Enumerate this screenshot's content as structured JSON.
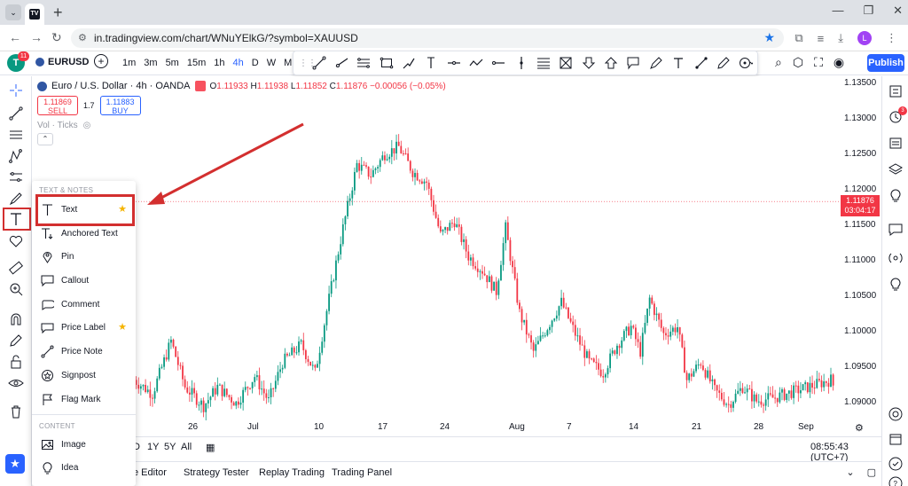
{
  "browser": {
    "url": "in.tradingview.com/chart/WNuYElkG/?symbol=XAUUSD",
    "profile_initial": "L",
    "tab_menu_glyph": "⌄",
    "new_tab_glyph": "+",
    "window_controls": [
      "—",
      "❐",
      "✕"
    ],
    "nav": {
      "back": "←",
      "forward": "→",
      "reload": "↻"
    }
  },
  "topbar": {
    "user_initial": "T",
    "notification_count": "11",
    "symbol": "EURUSD",
    "intervals": [
      "1m",
      "3m",
      "5m",
      "15m",
      "1h",
      "4h",
      "D",
      "W",
      "M"
    ],
    "active_interval": "4h",
    "publish_label": "Publish"
  },
  "chart": {
    "legend_title": "Euro / U.S. Dollar · 4h · OANDA",
    "ohlc": {
      "o_label": "O",
      "o": "1.11933",
      "h_label": "H",
      "h": "1.11938",
      "l_label": "L",
      "l": "1.11852",
      "c_label": "C",
      "c": "1.11876",
      "change": "−0.00056 (−0.05%)"
    },
    "sell": {
      "price": "1.11869",
      "label": "SELL"
    },
    "buy": {
      "price": "1.11883",
      "label": "BUY"
    },
    "spread": "1.7",
    "volume_label": "Vol · Ticks",
    "current_price": {
      "value": "1.11876",
      "countdown": "03:04:17"
    },
    "price_ticks": [
      "1.13500",
      "1.13000",
      "1.12500",
      "1.12000",
      "1.11500",
      "1.11000",
      "1.10500",
      "1.10000",
      "1.09500",
      "1.09000"
    ],
    "time_ticks": [
      "26",
      "Jul",
      "10",
      "17",
      "24",
      "Aug",
      "7",
      "14",
      "21",
      "28",
      "Sep"
    ],
    "colors": {
      "up": "#089981",
      "down": "#f23645"
    }
  },
  "chart_data": {
    "type": "candlestick",
    "title": "Euro / U.S. Dollar · 4h · OANDA",
    "ylim": [
      1.0875,
      1.1365
    ],
    "x_tick_labels": [
      "26",
      "Jul",
      "10",
      "17",
      "24",
      "Aug",
      "7",
      "14",
      "21",
      "28",
      "Sep"
    ],
    "y_tick_labels": [
      "1.13500",
      "1.13000",
      "1.12500",
      "1.12000",
      "1.11500",
      "1.11000",
      "1.10500",
      "1.10000",
      "1.09500",
      "1.09000"
    ],
    "last_close": 1.11876,
    "path_points": [
      [
        0,
        1.0935
      ],
      [
        8,
        1.0915
      ],
      [
        16,
        1.099
      ],
      [
        22,
        1.0925
      ],
      [
        30,
        1.0898
      ],
      [
        36,
        1.0925
      ],
      [
        44,
        1.0902
      ],
      [
        52,
        1.094
      ],
      [
        58,
        1.0905
      ],
      [
        64,
        1.096
      ],
      [
        72,
        1.0985
      ],
      [
        78,
        1.0945
      ],
      [
        84,
        1.105
      ],
      [
        90,
        1.115
      ],
      [
        96,
        1.124
      ],
      [
        102,
        1.1225
      ],
      [
        108,
        1.1255
      ],
      [
        114,
        1.1265
      ],
      [
        120,
        1.123
      ],
      [
        126,
        1.1215
      ],
      [
        132,
        1.114
      ],
      [
        138,
        1.116
      ],
      [
        144,
        1.111
      ],
      [
        150,
        1.109
      ],
      [
        156,
        1.106
      ],
      [
        160,
        1.115
      ],
      [
        166,
        1.103
      ],
      [
        172,
        1.0975
      ],
      [
        178,
        1.101
      ],
      [
        184,
        1.1045
      ],
      [
        190,
        1.1
      ],
      [
        196,
        1.096
      ],
      [
        202,
        1.0945
      ],
      [
        208,
        1.0985
      ],
      [
        214,
        1.101
      ],
      [
        218,
        1.0975
      ],
      [
        222,
        1.105
      ],
      [
        228,
        1.1
      ],
      [
        234,
        1.101
      ],
      [
        238,
        1.0935
      ],
      [
        244,
        1.096
      ],
      [
        250,
        1.092
      ],
      [
        256,
        1.09
      ],
      [
        262,
        1.0925
      ],
      [
        268,
        1.0905
      ],
      [
        276,
        1.091
      ],
      [
        300,
        1.0935
      ],
      [
        304,
        1.0905
      ]
    ]
  },
  "range_bar": {
    "ranges": [
      "D",
      "1Y",
      "5Y",
      "All"
    ],
    "clock": "08:55:43 (UTC+7)"
  },
  "bottom_tabs": [
    "e Editor",
    "Strategy Tester",
    "Replay Trading",
    "Trading Panel"
  ],
  "menu": {
    "section_text": "TEXT & NOTES",
    "section_content": "CONTENT",
    "items": [
      {
        "label": "Text",
        "starred": true
      },
      {
        "label": "Anchored Text",
        "starred": false
      },
      {
        "label": "Pin",
        "starred": false
      },
      {
        "label": "Callout",
        "starred": false
      },
      {
        "label": "Comment",
        "starred": false
      },
      {
        "label": "Price Label",
        "starred": true
      },
      {
        "label": "Price Note",
        "starred": false
      },
      {
        "label": "Signpost",
        "starred": false
      },
      {
        "label": "Flag Mark",
        "starred": false
      }
    ],
    "content_items": [
      {
        "label": "Image"
      },
      {
        "label": "Idea"
      }
    ],
    "star_glyph": "★"
  },
  "right_sidebar": {
    "alert_badge": "3"
  },
  "annotation_color": "#d32f2f"
}
